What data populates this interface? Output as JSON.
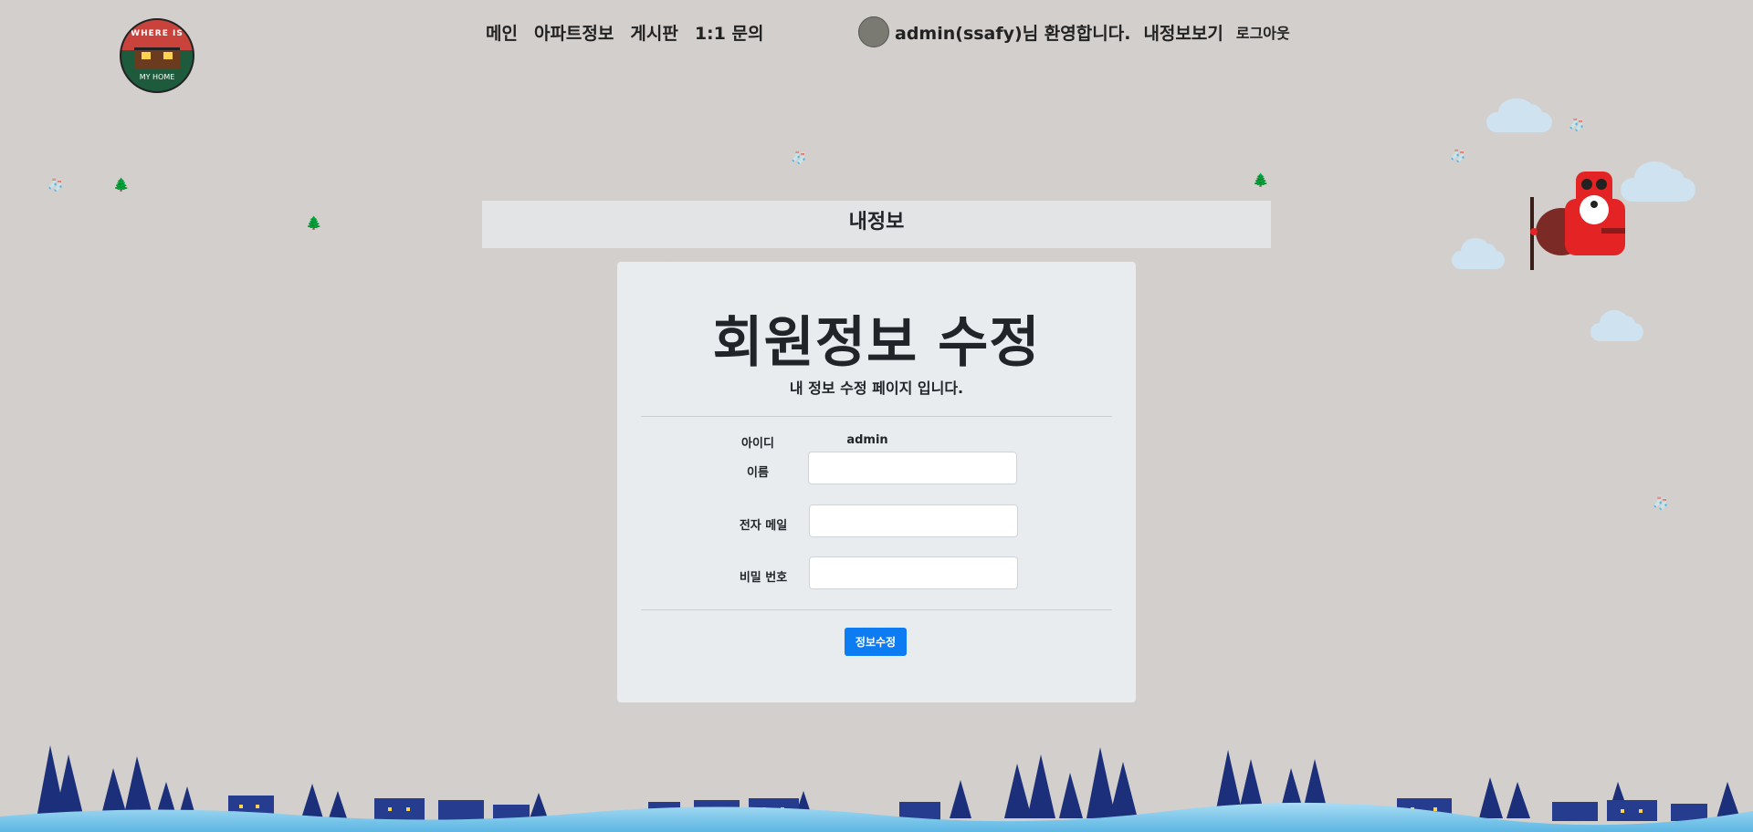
{
  "logo": {
    "top_text": "WHERE IS",
    "bottom_text": "MY HOME"
  },
  "nav": {
    "items": [
      "메인",
      "아파트정보",
      "게시판",
      "1:1 문의"
    ]
  },
  "user": {
    "welcome": "admin(ssafy)님 환영합니다.",
    "myinfo": "내정보보기",
    "logout": "로그아웃"
  },
  "band": {
    "title": "내정보"
  },
  "form": {
    "title": "회원정보 수정",
    "subtitle": "내 정보 수정 페이지 입니다.",
    "id_label": "아이디",
    "id_value": "admin",
    "name_label": "이름",
    "name_value": "",
    "email_label": "전자 메일",
    "email_value": "",
    "password_label": "비밀 번호",
    "password_value": "",
    "submit_label": "정보수정"
  },
  "colors": {
    "background": "#d3cfcc",
    "band": "#e3e4e6",
    "card": "#e9ecef",
    "button": "#0d7bf2",
    "forest": "#1b2f7a",
    "snow": "#8fd0ef"
  }
}
